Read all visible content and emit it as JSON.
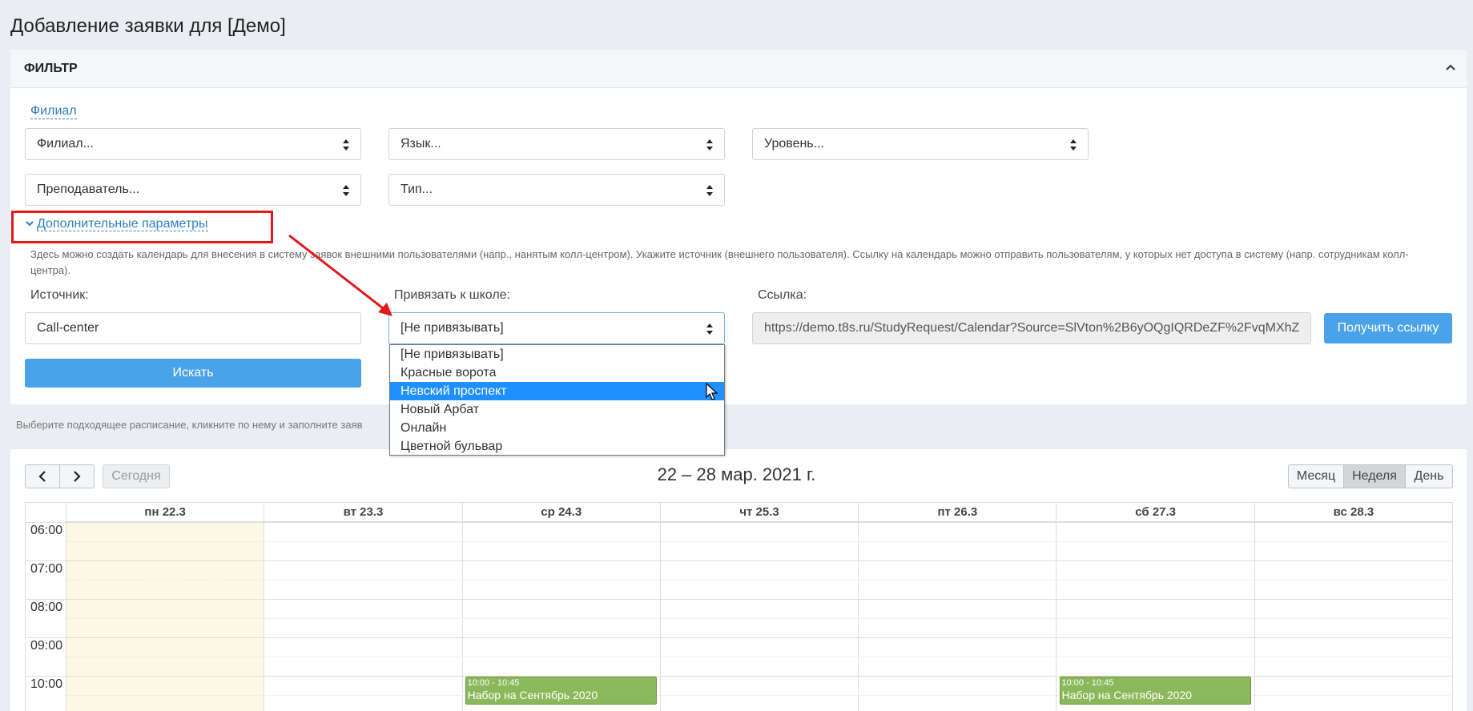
{
  "page": {
    "title": "Добавление заявки для [Демо]"
  },
  "filter": {
    "header": "ФИЛЬТР",
    "filial_link": "Филиал",
    "selects": {
      "filial": "Филиал...",
      "language": "Язык...",
      "level": "Уровень...",
      "teacher": "Преподаватель...",
      "type": "Тип..."
    },
    "advanced_link": "Дополнительные параметры",
    "hint": "Здесь можно создать календарь для внесения в систему заявок внешними пользователями (напр., нанятым колл-центром). Укажите источник (внешнего пользователя). Ссылку на календарь можно отправить пользователям, у которых нет доступа в систему (напр. сотрудникам колл-центра).",
    "source_label": "Источник:",
    "source_value": "Call-center",
    "school_label": "Привязать к школе:",
    "school_value": "[Не привязывать]",
    "link_label": "Ссылка:",
    "link_value": "https://demo.t8s.ru/StudyRequest/Calendar?Source=SlVton%2B6yOQgIQRDeZF%2FvqMXhZ",
    "get_link_button": "Получить ссылку",
    "search_button": "Искать"
  },
  "dropdown": {
    "options": [
      "[Не привязывать]",
      "Красные ворота",
      "Невский проспект",
      "Новый Арбат",
      "Онлайн",
      "Цветной бульвар"
    ],
    "highlighted": "Невский проспект"
  },
  "calendar": {
    "hint": "Выберите подходящее расписание, кликните по нему и заполните заяв",
    "today_button": "Сегодня",
    "title": "22 – 28 мар. 2021 г.",
    "views": [
      "Месяц",
      "Неделя",
      "День"
    ],
    "active_view": "Неделя",
    "days": [
      "пн 22.3",
      "вт 23.3",
      "ср 24.3",
      "чт 25.3",
      "пт 26.3",
      "сб 27.3",
      "вс 28.3"
    ],
    "times": [
      "06:00",
      "07:00",
      "08:00",
      "09:00",
      "10:00"
    ],
    "events": [
      {
        "day_index": 2,
        "time": "10:00 - 10:45",
        "name": "Набор на Сентябрь 2020"
      },
      {
        "day_index": 5,
        "time": "10:00 - 10:45",
        "name": "Набор на Сентябрь 2020"
      }
    ]
  },
  "colors": {
    "primary": "#4aa3e8",
    "link": "#2d7fc1",
    "highlight": "#1e90ff",
    "event": "#8cb85c",
    "today": "#fcf8e3",
    "annotation": "#e4181c"
  }
}
